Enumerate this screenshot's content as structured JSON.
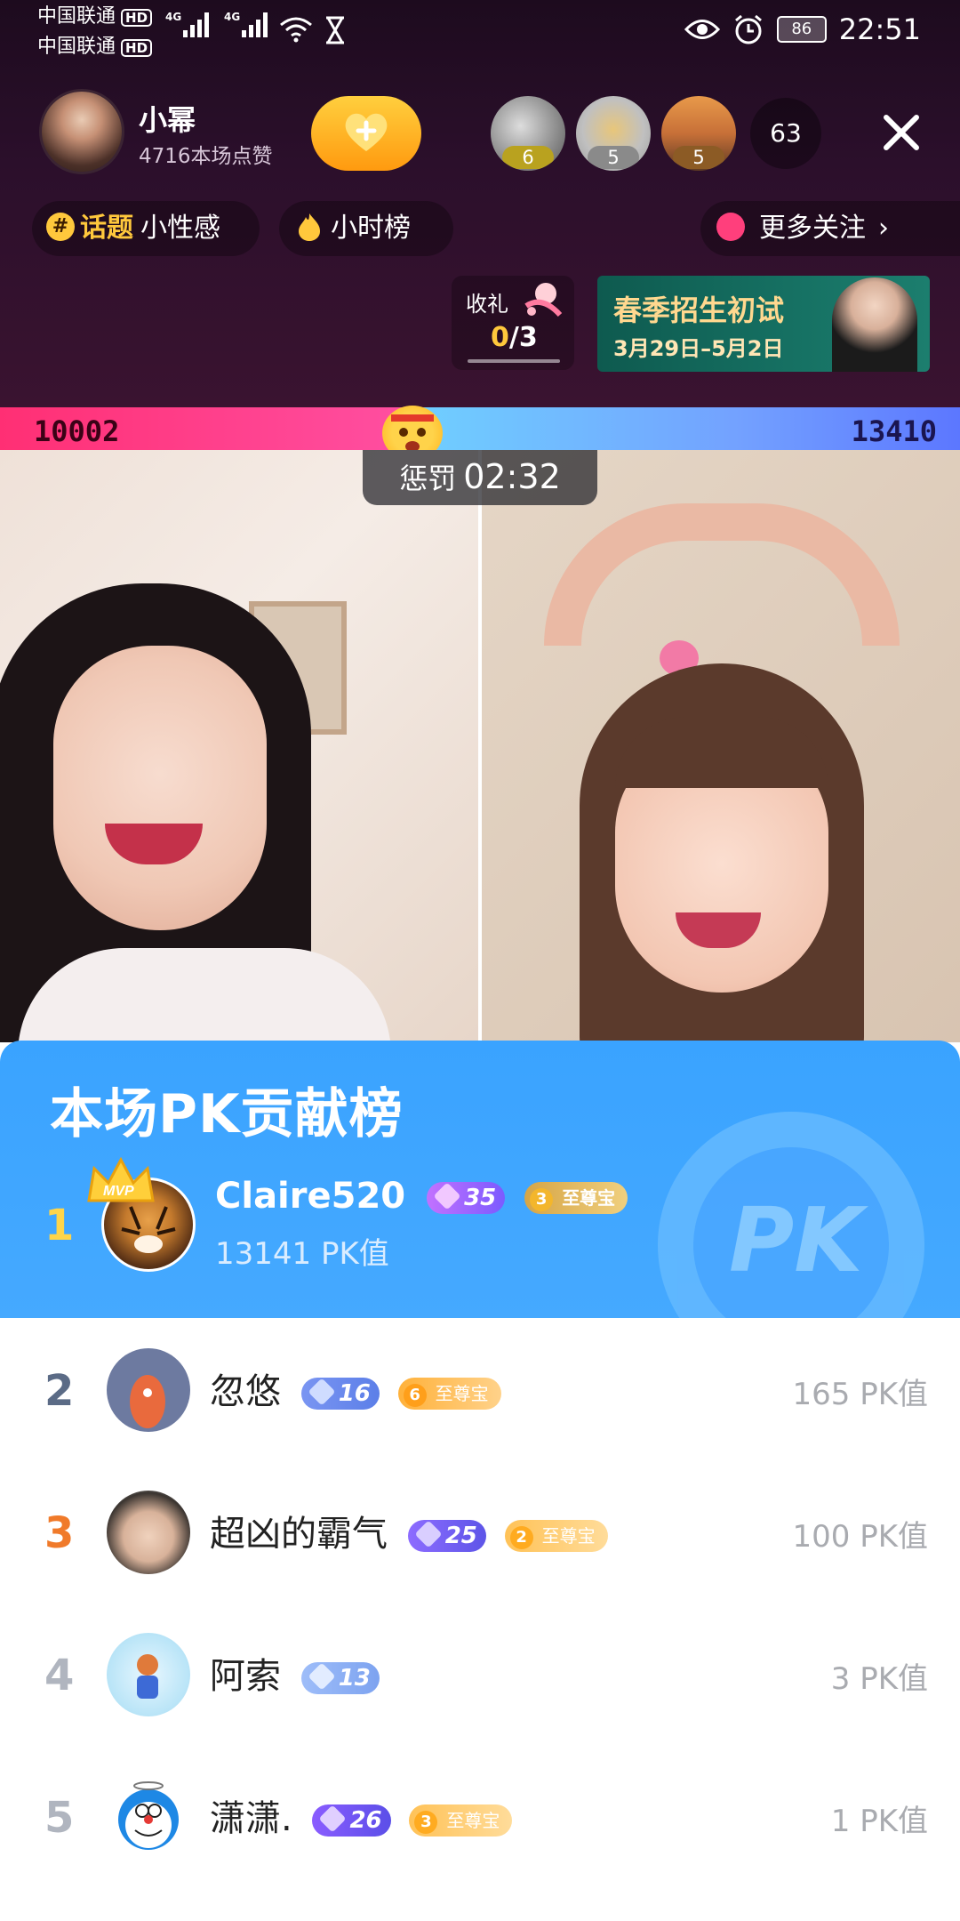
{
  "status": {
    "carrier1": "中国联通",
    "carrier2": "中国联通",
    "hd": "HD",
    "net": "4G",
    "battery": "86",
    "time": "22:51"
  },
  "host": {
    "name": "小幂",
    "likes": "4716本场点赞"
  },
  "viewers": [
    {
      "count": "6",
      "color": "#9b8f2a"
    },
    {
      "count": "5",
      "color": "#7b7b7b"
    },
    {
      "count": "5",
      "color": "#7b5a2a"
    }
  ],
  "viewer_total": "63",
  "chips": {
    "topic_label": "话题",
    "topic_name": "小性感",
    "hour_rank": "小时榜",
    "more_follow": "更多关注"
  },
  "gift": {
    "label": "收礼",
    "done": "0",
    "total": "/3"
  },
  "banner": {
    "title": "春季招生初试",
    "dates": "3月29日–5月2日"
  },
  "pk": {
    "left_score": "10002",
    "right_score": "13410",
    "left_fraction": 0.427,
    "punish_label": "惩罚",
    "timer": "02:32"
  },
  "panel": {
    "title": "本场PK贡献榜"
  },
  "top_rank": {
    "rank": "1",
    "name": "Claire520",
    "level": "35",
    "vip_level": "3",
    "vip_label": "至尊宝",
    "score": "13141 PK值",
    "mvp": "MVP"
  },
  "rows": [
    {
      "rank": "2",
      "name": "忽悠",
      "level": "16",
      "vip_level": "6",
      "vip_label": "至尊宝",
      "score": "165 PK值",
      "rank_color": "#5b6b86"
    },
    {
      "rank": "3",
      "name": "超凶的霸气",
      "level": "25",
      "vip_level": "2",
      "vip_label": "至尊宝",
      "score": "100 PK值",
      "rank_color": "#f07a2a"
    },
    {
      "rank": "4",
      "name": "阿索",
      "level": "13",
      "vip_level": "",
      "vip_label": "",
      "score": "3 PK值",
      "rank_color": "#b0b5bf"
    },
    {
      "rank": "5",
      "name": "潇潇.",
      "level": "26",
      "vip_level": "3",
      "vip_label": "至尊宝",
      "score": "1 PK值",
      "rank_color": "#b0b5bf"
    }
  ]
}
